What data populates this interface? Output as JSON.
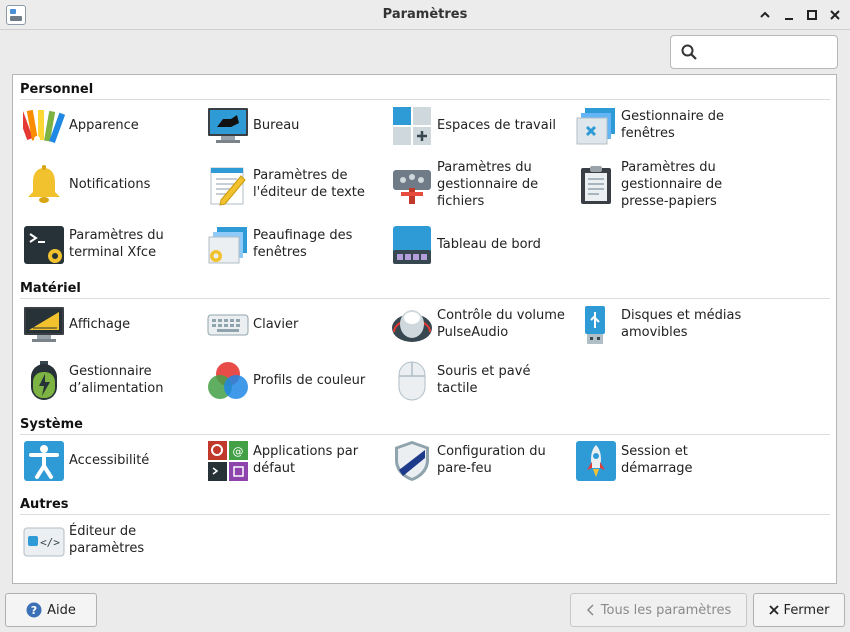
{
  "window": {
    "title": "Paramètres"
  },
  "search": {
    "placeholder": "",
    "value": ""
  },
  "sections": {
    "personnel": {
      "title": "Personnel",
      "items": [
        {
          "label": "Apparence",
          "icon": "appearance-palette-icon"
        },
        {
          "label": "Bureau",
          "icon": "desktop-icon"
        },
        {
          "label": "Espaces de travail",
          "icon": "workspaces-icon"
        },
        {
          "label": "Gestionnaire de fenêtres",
          "icon": "window-manager-icon"
        },
        {
          "label": "Notifications",
          "icon": "bell-icon"
        },
        {
          "label": "Paramètres de l'éditeur de texte",
          "icon": "text-editor-icon"
        },
        {
          "label": "Paramètres du gestionnaire de fichiers",
          "icon": "file-manager-icon"
        },
        {
          "label": "Paramètres du gestionnaire de presse-papiers",
          "icon": "clipboard-icon"
        },
        {
          "label": "Paramètres du terminal Xfce",
          "icon": "terminal-icon"
        },
        {
          "label": "Peaufinage des fenêtres",
          "icon": "window-tweaks-icon"
        },
        {
          "label": "Tableau de bord",
          "icon": "panel-icon"
        }
      ]
    },
    "materiel": {
      "title": "Matériel",
      "items": [
        {
          "label": "Affichage",
          "icon": "display-icon"
        },
        {
          "label": "Clavier",
          "icon": "keyboard-icon"
        },
        {
          "label": "Contrôle du volume PulseAudio",
          "icon": "volume-knob-icon"
        },
        {
          "label": "Disques et médias amovibles",
          "icon": "usb-drive-icon"
        },
        {
          "label": "Gestionnaire d’alimentation",
          "icon": "battery-icon"
        },
        {
          "label": "Profils de couleur",
          "icon": "color-profiles-icon"
        },
        {
          "label": "Souris et pavé tactile",
          "icon": "mouse-icon"
        }
      ]
    },
    "systeme": {
      "title": "Système",
      "items": [
        {
          "label": "Accessibilité",
          "icon": "accessibility-icon"
        },
        {
          "label": "Applications par défaut",
          "icon": "default-apps-icon"
        },
        {
          "label": "Configuration du pare-feu",
          "icon": "firewall-shield-icon"
        },
        {
          "label": "Session et démarrage",
          "icon": "rocket-icon"
        }
      ]
    },
    "autres": {
      "title": "Autres",
      "items": [
        {
          "label": "Éditeur de paramètres",
          "icon": "settings-editor-icon"
        }
      ]
    }
  },
  "footer": {
    "help_label": "Aide",
    "all_settings_label": "Tous les paramètres",
    "close_label": "Fermer"
  },
  "colors": {
    "accent": "#2f9bd6",
    "bell": "#f2c12e"
  }
}
